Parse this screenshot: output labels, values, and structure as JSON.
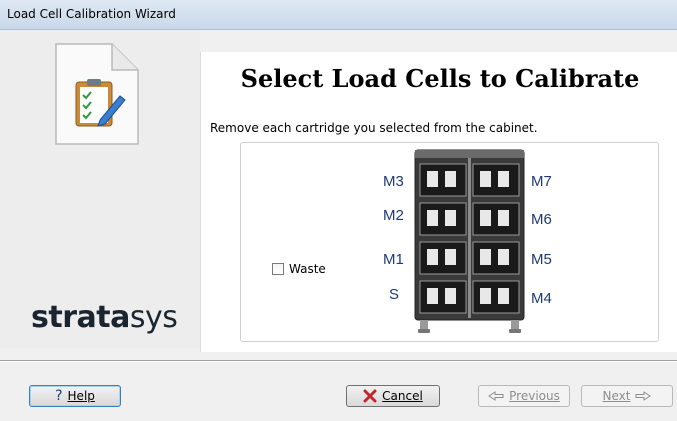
{
  "window": {
    "title": "Load Cell Calibration Wizard"
  },
  "sidebar": {
    "logo_bold": "strata",
    "logo_light": "sys",
    "icon": "clipboard-document-icon"
  },
  "main": {
    "heading": "Select Load Cells to Calibrate",
    "instruction": "Remove each cartridge you selected from the cabinet.",
    "waste_checkbox": {
      "label": "Waste",
      "checked": false
    },
    "left_slots": [
      "M3",
      "M2",
      "M1",
      "S"
    ],
    "right_slots": [
      "M7",
      "M6",
      "M5",
      "M4"
    ]
  },
  "buttons": {
    "help": "Help",
    "cancel": "Cancel",
    "previous": "Previous",
    "next": "Next"
  },
  "colors": {
    "slot_label": "#1f3a78",
    "cancel_icon": "#c0262c"
  }
}
